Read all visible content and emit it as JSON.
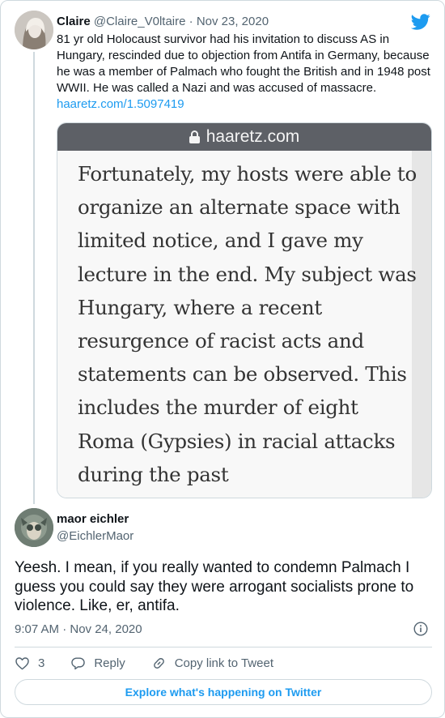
{
  "parent_tweet": {
    "avatar_icon": "user-avatar-icon",
    "name": "Claire",
    "handle": "@Claire_V0ltaire",
    "date": "· Nov 23, 2020",
    "text": "81 yr old Holocaust survivor had his invitation to discuss AS in Hungary, rescinded due to objection from Antifa in Germany, because he was a member of Palmach who fought the British and in 1948 post WWII. He was called a Nazi and was accused of massacre.",
    "link": "haaretz.com/1.5097419",
    "media": {
      "site": "haaretz.com",
      "article_text": "Fortunately, my hosts were able to organize an alternate space with limited notice, and I gave my lecture in the end. My subject was Hungary, where a recent resurgence of racist acts and statements can be observed. This includes the murder of eight Roma (Gypsies) in racial attacks during the past"
    }
  },
  "main_tweet": {
    "name": "maor eichler",
    "handle": "@EichlerMaor",
    "text": "Yeesh. I mean, if you really wanted to condemn Palmach I guess you could say they were arrogant socialists prone to violence. Like, er, antifa.",
    "timestamp": "9:07 AM · Nov 24, 2020"
  },
  "actions": {
    "like_count": "3",
    "reply_label": "Reply",
    "copy_label": "Copy link to Tweet"
  },
  "explore_label": "Explore what's happening on Twitter",
  "colors": {
    "accent": "#1d9bf0",
    "muted": "#536471",
    "border": "#cfd9de",
    "text": "#0f1419"
  }
}
